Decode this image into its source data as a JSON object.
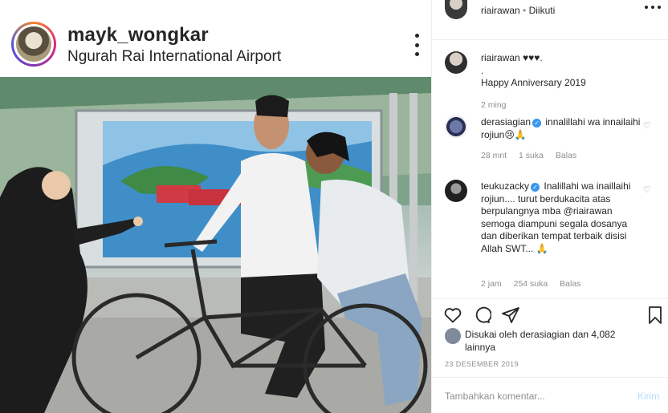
{
  "post": {
    "username": "mayk_wongkar",
    "location": "Ngurah Rai International Airport"
  },
  "sidebar": {
    "owner": {
      "username": "riairawan",
      "separator": "•",
      "follow_status": "Diikuti"
    },
    "caption": {
      "username": "riairawan",
      "text_line1": "♥♥♥.",
      "text_line2": ".",
      "text_line3": "Happy Anniversary 2019",
      "time": "2 ming"
    },
    "comments": [
      {
        "username": "derasiagian",
        "verified": true,
        "text": "innalillahi wa innailaihi rojiun😢🙏",
        "time": "28 mnt",
        "likes": "1 suka",
        "reply": "Balas"
      },
      {
        "username": "teukuzacky",
        "verified": true,
        "text": "Inalillahi wa inaillaihi rojiun.... turut berdukacita atas berpulangnya mba @riairawan semoga diampuni segala dosanya dan diberikan tempat terbaik disisi Allah SWT... 🙏",
        "time": "2 jam",
        "likes": "254 suka",
        "reply": "Balas"
      }
    ],
    "likes_text": "Disukai oleh derasiagian dan 4,082 lainnya",
    "date": "23 DESEMBER 2019",
    "comment_placeholder": "Tambahkan komentar...",
    "send_label": "Kirim",
    "colors": {
      "link_blue": "#3897f0",
      "muted": "#8e8e8e",
      "send_disabled": "#b2dffc"
    },
    "icons": [
      "heart-icon",
      "comment-icon",
      "share-icon",
      "bookmark-icon"
    ]
  }
}
